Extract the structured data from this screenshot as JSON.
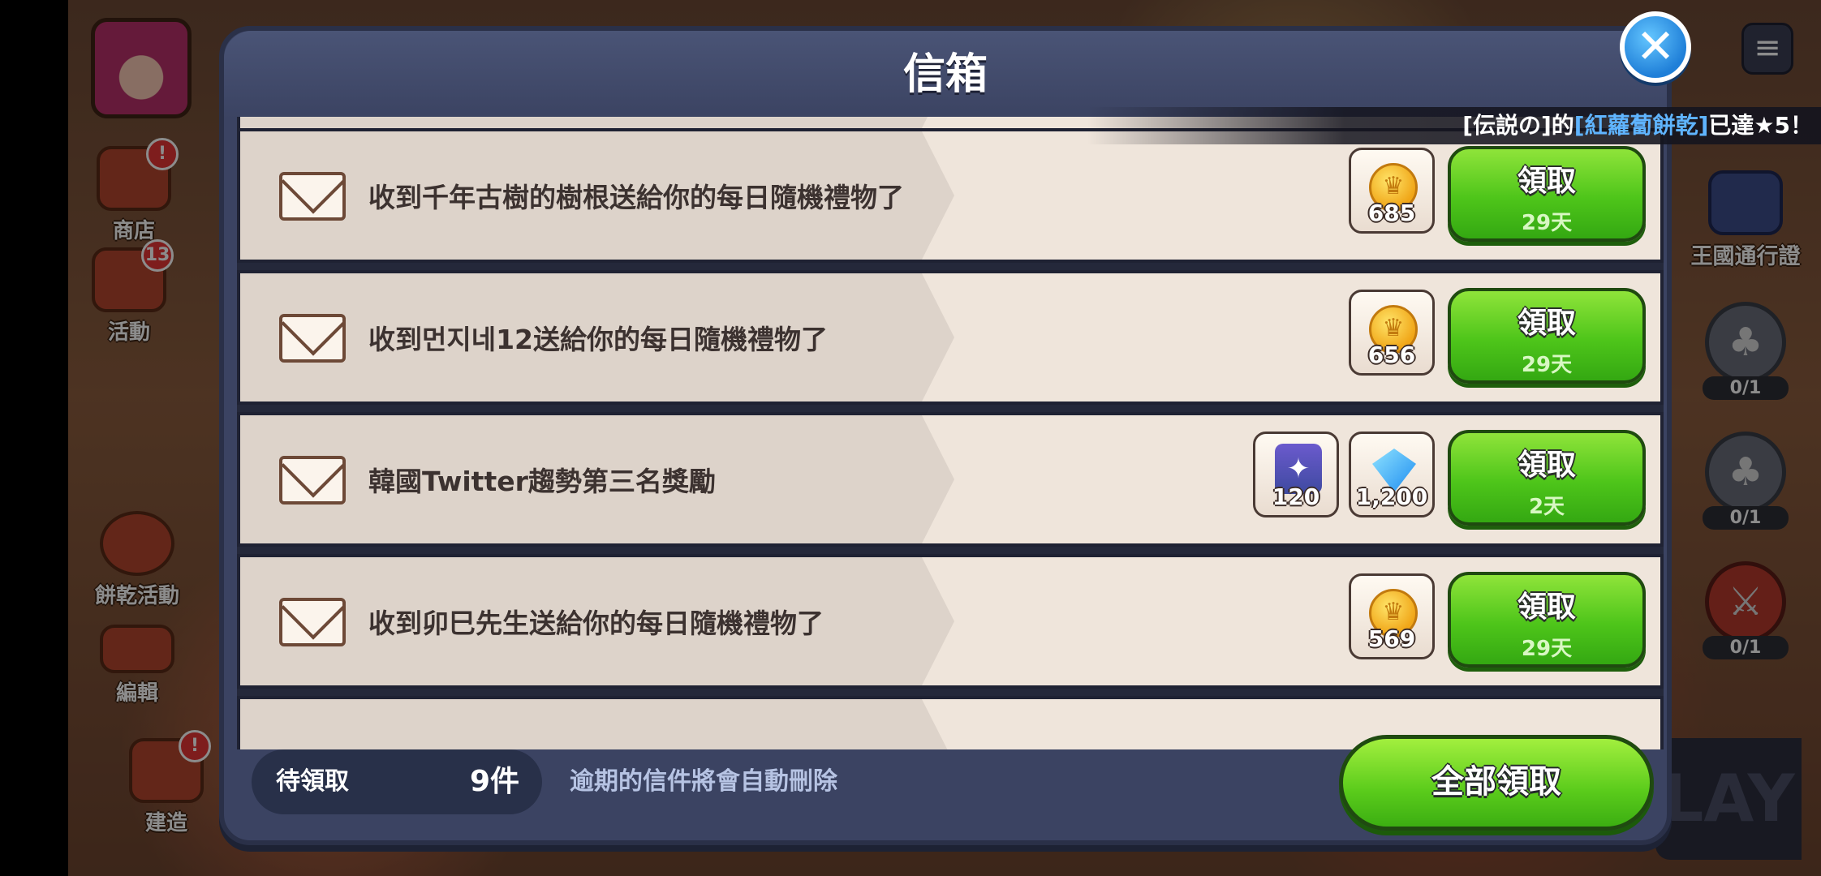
{
  "sidebar_left": {
    "items": [
      {
        "label": "商店",
        "badge": "!"
      },
      {
        "label": "活動",
        "badge": "13"
      },
      {
        "label": "餅乾活動",
        "badge": ""
      },
      {
        "label": "編輯",
        "badge": ""
      },
      {
        "label": "建造",
        "badge": "!"
      }
    ]
  },
  "sidebar_right": {
    "kingdom_pass_label": "王國通行證",
    "quests": [
      {
        "count": "0/1",
        "icon": "stump-icon"
      },
      {
        "count": "0/1",
        "icon": "stump-icon"
      },
      {
        "count": "0/1",
        "icon": "sword-icon"
      }
    ]
  },
  "play_button_label": "LAY",
  "ticker": {
    "prefix": "[伝説の]的",
    "highlight": "[紅蘿蔔餅乾]",
    "suffix": "已達★5！"
  },
  "mailbox": {
    "title": "信箱",
    "close_symbol": "✕",
    "mails": [
      {
        "text": "收到千年古樹的樹根送給你的每日隨機禮物了",
        "rewards": [
          {
            "type": "coin",
            "amount": "685"
          }
        ],
        "claim_label": "領取",
        "days_left": "29天"
      },
      {
        "text": "收到먼지네12送給你的每日隨機禮物了",
        "rewards": [
          {
            "type": "coin",
            "amount": "656"
          }
        ],
        "claim_label": "領取",
        "days_left": "29天"
      },
      {
        "text": "韓國Twitter趨勢第三名獎勵",
        "rewards": [
          {
            "type": "box",
            "amount": "120"
          },
          {
            "type": "gem",
            "amount": "1,200"
          }
        ],
        "claim_label": "領取",
        "days_left": "2天"
      },
      {
        "text": "收到卯巳先生送給你的每日隨機禮物了",
        "rewards": [
          {
            "type": "coin",
            "amount": "569"
          }
        ],
        "claim_label": "領取",
        "days_left": "29天"
      }
    ],
    "footer": {
      "pending_label": "待領取",
      "pending_count": "9件",
      "expire_note": "逾期的信件將會自動刪除",
      "claim_all_label": "全部領取"
    }
  }
}
